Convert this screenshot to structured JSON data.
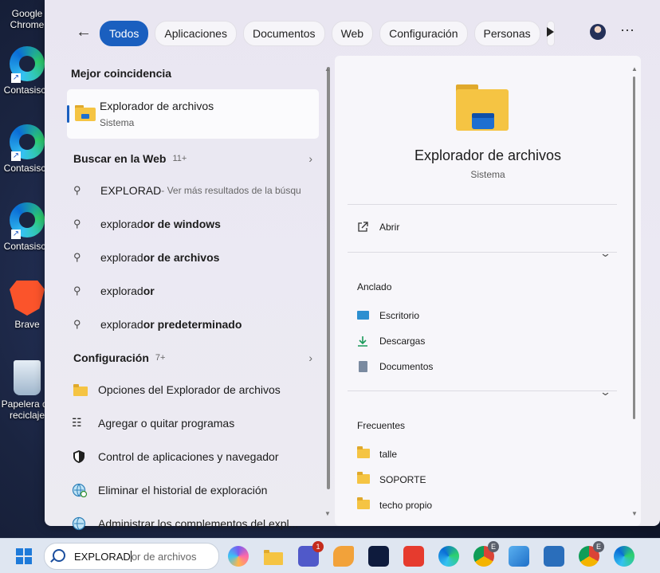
{
  "desktop": {
    "icons": [
      {
        "label": "Google\nChrome"
      },
      {
        "label": "Contasiscc"
      },
      {
        "label": "Contasiscc"
      },
      {
        "label": "Contasiscc"
      },
      {
        "label": "Brave"
      },
      {
        "label": "Papelera de\nreciclaje"
      }
    ]
  },
  "filters": {
    "tabs": [
      "Todos",
      "Aplicaciones",
      "Documentos",
      "Web",
      "Configuración",
      "Personas"
    ],
    "active": "Todos"
  },
  "best_match": {
    "heading": "Mejor coincidencia",
    "title": "Explorador de archivos",
    "subtitle": "Sistema"
  },
  "web": {
    "heading": "Buscar en la Web",
    "count": "11+",
    "first_query": "EXPLORAD",
    "first_hint": " - Ver más resultados de la búsqu",
    "suggestions": [
      {
        "prefix": "explorad",
        "bold": "or de windows"
      },
      {
        "prefix": "explorad",
        "bold": "or de archivos"
      },
      {
        "prefix": "explorad",
        "bold": "or"
      },
      {
        "prefix": "explorad",
        "bold": "or predeterminado"
      }
    ]
  },
  "settings": {
    "heading": "Configuración",
    "count": "7+",
    "items": [
      "Opciones del Explorador de archivos",
      "Agregar o quitar programas",
      "Control de aplicaciones y navegador",
      "Eliminar el historial de exploración",
      "Administrar los complementos del expl..."
    ]
  },
  "preview": {
    "title": "Explorador de archivos",
    "subtitle": "Sistema",
    "open_label": "Abrir",
    "pinned_heading": "Anclado",
    "pinned": [
      "Escritorio",
      "Descargas",
      "Documentos"
    ],
    "frequent_heading": "Frecuentes",
    "frequent": [
      "talle",
      "SOPORTE",
      "techo propio"
    ]
  },
  "taskbar": {
    "search_typed": "EXPLORAD",
    "search_ghost": "or de archivos",
    "teams_badge": "1",
    "chrome_badge": "E"
  },
  "colors": {
    "accent": "#1a5fbf",
    "folder_yellow": "#f5c443"
  }
}
